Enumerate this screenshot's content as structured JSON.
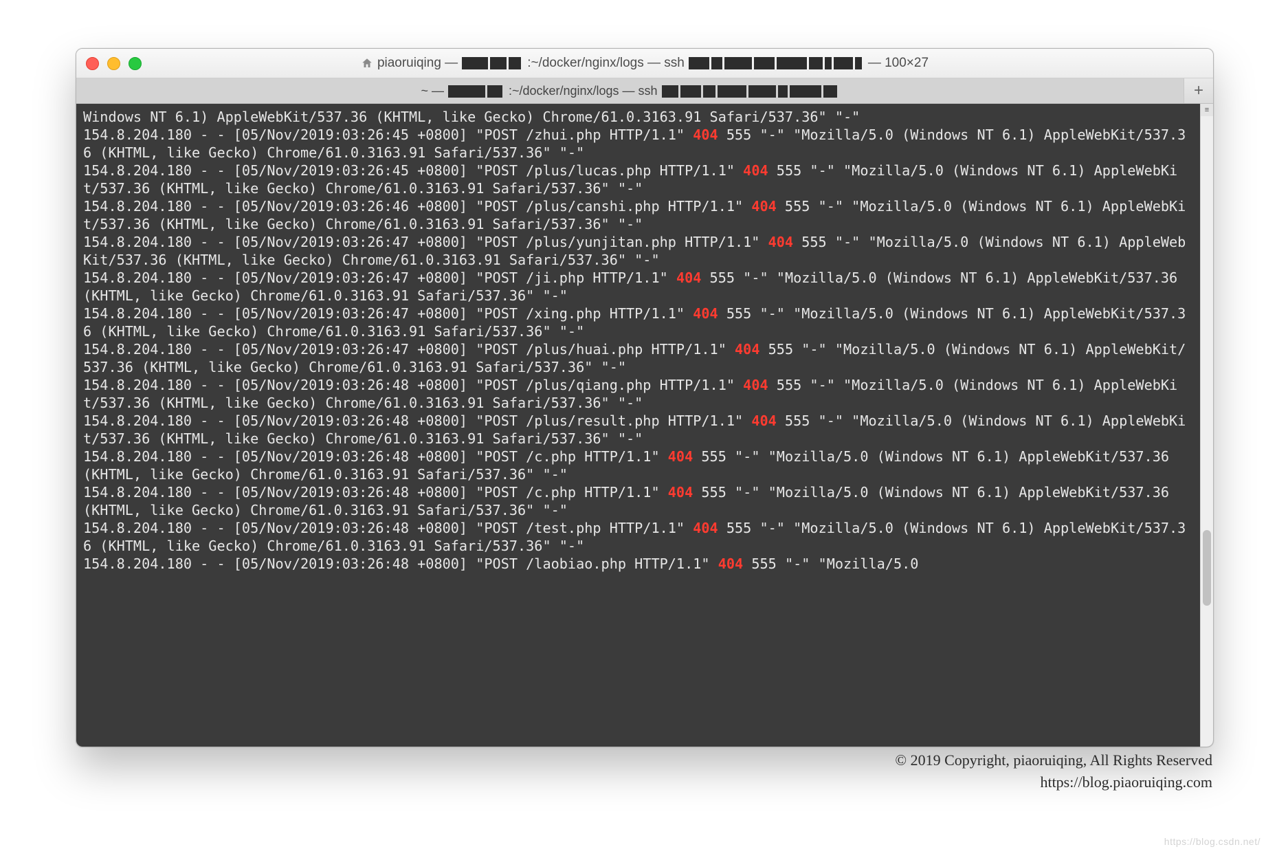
{
  "window": {
    "title_prefix": "piaoruiqing — ",
    "title_path": ":~/docker/nginx/logs — ssh ",
    "title_dims": " — 100×27"
  },
  "tab": {
    "prefix": "~ —",
    "path": " :~/docker/nginx/logs — ssh"
  },
  "log": {
    "ua_fragment_first": "Windows NT 6.1) AppleWebKit/537.36 (KHTML, like Gecko) Chrome/61.0.3163.91 Safari/537.36\" \"-\"",
    "ua_full": "\"Mozilla/5.0 (Windows NT 6.1) AppleWebKit/537.36 (KHTML, like Gecko) Chrome/61.0.3163.91 Safari/537.36\" \"-\"",
    "ip": "154.8.204.180",
    "entries": [
      {
        "ts": "[05/Nov/2019:03:26:45 +0800]",
        "req": "\"POST /zhui.php HTTP/1.1\"",
        "status": "404",
        "size": "555"
      },
      {
        "ts": "[05/Nov/2019:03:26:45 +0800]",
        "req": "\"POST /plus/lucas.php HTTP/1.1\"",
        "status": "404",
        "size": "555"
      },
      {
        "ts": "[05/Nov/2019:03:26:46 +0800]",
        "req": "\"POST /plus/canshi.php HTTP/1.1\"",
        "status": "404",
        "size": "555"
      },
      {
        "ts": "[05/Nov/2019:03:26:47 +0800]",
        "req": "\"POST /plus/yunjitan.php HTTP/1.1\"",
        "status": "404",
        "size": "555"
      },
      {
        "ts": "[05/Nov/2019:03:26:47 +0800]",
        "req": "\"POST /ji.php HTTP/1.1\"",
        "status": "404",
        "size": "555"
      },
      {
        "ts": "[05/Nov/2019:03:26:47 +0800]",
        "req": "\"POST /xing.php HTTP/1.1\"",
        "status": "404",
        "size": "555"
      },
      {
        "ts": "[05/Nov/2019:03:26:47 +0800]",
        "req": "\"POST /plus/huai.php HTTP/1.1\"",
        "status": "404",
        "size": "555"
      },
      {
        "ts": "[05/Nov/2019:03:26:48 +0800]",
        "req": "\"POST /plus/qiang.php HTTP/1.1\"",
        "status": "404",
        "size": "555"
      },
      {
        "ts": "[05/Nov/2019:03:26:48 +0800]",
        "req": "\"POST /plus/result.php HTTP/1.1\"",
        "status": "404",
        "size": "555"
      },
      {
        "ts": "[05/Nov/2019:03:26:48 +0800]",
        "req": "\"POST /c.php HTTP/1.1\"",
        "status": "404",
        "size": "555"
      },
      {
        "ts": "[05/Nov/2019:03:26:48 +0800]",
        "req": "\"POST /c.php HTTP/1.1\"",
        "status": "404",
        "size": "555"
      },
      {
        "ts": "[05/Nov/2019:03:26:48 +0800]",
        "req": "\"POST /test.php HTTP/1.1\"",
        "status": "404",
        "size": "555"
      },
      {
        "ts": "[05/Nov/2019:03:26:48 +0800]",
        "req": "\"POST /laobiao.php HTTP/1.1\"",
        "status": "404",
        "size": "555",
        "truncated_ua": "\"Mozilla/5.0"
      }
    ]
  },
  "copyright": {
    "line1": "© 2019 Copyright,  piaoruiqing,  All Rights Reserved",
    "line2": "https://blog.piaoruiqing.com"
  },
  "watermark": "https://blog.csdn.net/"
}
